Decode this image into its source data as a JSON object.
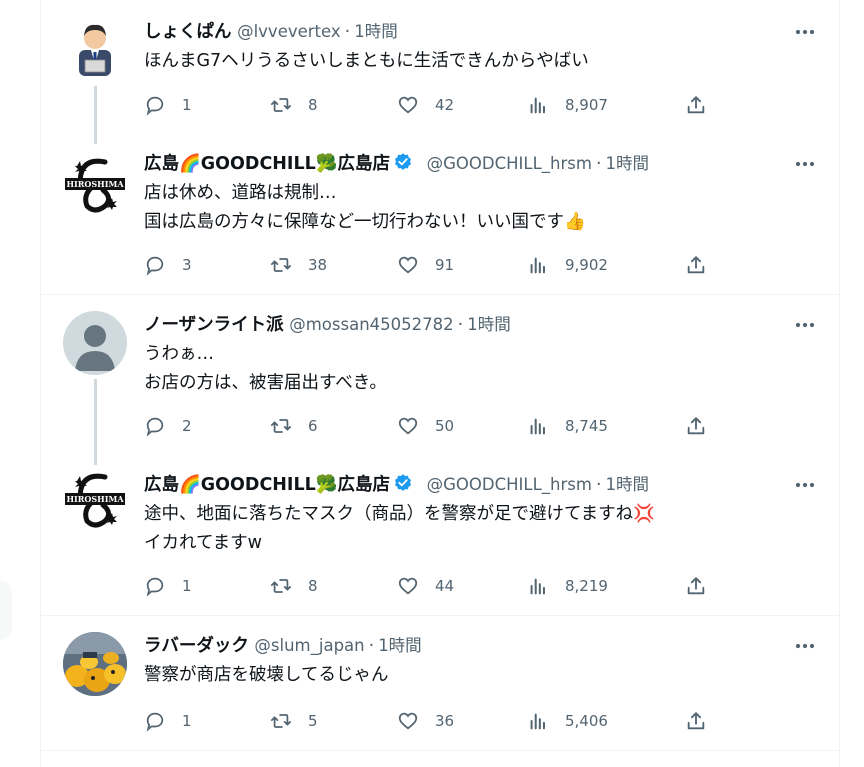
{
  "tweets": [
    {
      "name": "しょくぱん",
      "handle": "@lvvevertex",
      "time": "1時間",
      "lines": [
        "ほんまG7ヘリうるさいしまともに生活できんからやばい"
      ],
      "replies": "1",
      "retweets": "8",
      "likes": "42",
      "views": "8,907",
      "avatar": "salaryman-avatar"
    },
    {
      "name_prefix": "広島",
      "name_mid": "GOODCHILL",
      "name_suffix": "広島店",
      "handle": "@GOODCHILL_hrsm",
      "time": "1時間",
      "lines": [
        "店は休め、道路は規制…",
        "国は広島の方々に保障など一切行わない！いい国です👍"
      ],
      "replies": "3",
      "retweets": "38",
      "likes": "91",
      "views": "9,902",
      "avatar_text": "HIROSHIMA"
    },
    {
      "name": "ノーザンライト派",
      "handle": "@mossan45052782",
      "time": "1時間",
      "lines": [
        "うわぁ…",
        "お店の方は、被害届出すべき。"
      ],
      "replies": "2",
      "retweets": "6",
      "likes": "50",
      "views": "8,745",
      "avatar": "default-avatar"
    },
    {
      "name_prefix": "広島",
      "name_mid": "GOODCHILL",
      "name_suffix": "広島店",
      "handle": "@GOODCHILL_hrsm",
      "time": "1時間",
      "lines": [
        "途中、地面に落ちたマスク（商品）を警察が足で避けてますね💢",
        "イカれてますw"
      ],
      "replies": "1",
      "retweets": "8",
      "likes": "44",
      "views": "8,219",
      "avatar_text": "HIROSHIMA"
    },
    {
      "name": "ラバーダック",
      "handle": "@slum_japan",
      "time": "1時間",
      "lines": [
        "警察が商店を破壊してるじゃん"
      ],
      "replies": "1",
      "retweets": "5",
      "likes": "36",
      "views": "5,406",
      "avatar": "duck-photo-avatar"
    }
  ],
  "colors": {
    "text": "#0f1419",
    "muted": "#536471",
    "border": "#eff3f4",
    "verified": "#1d9bf0"
  },
  "dot": "·"
}
